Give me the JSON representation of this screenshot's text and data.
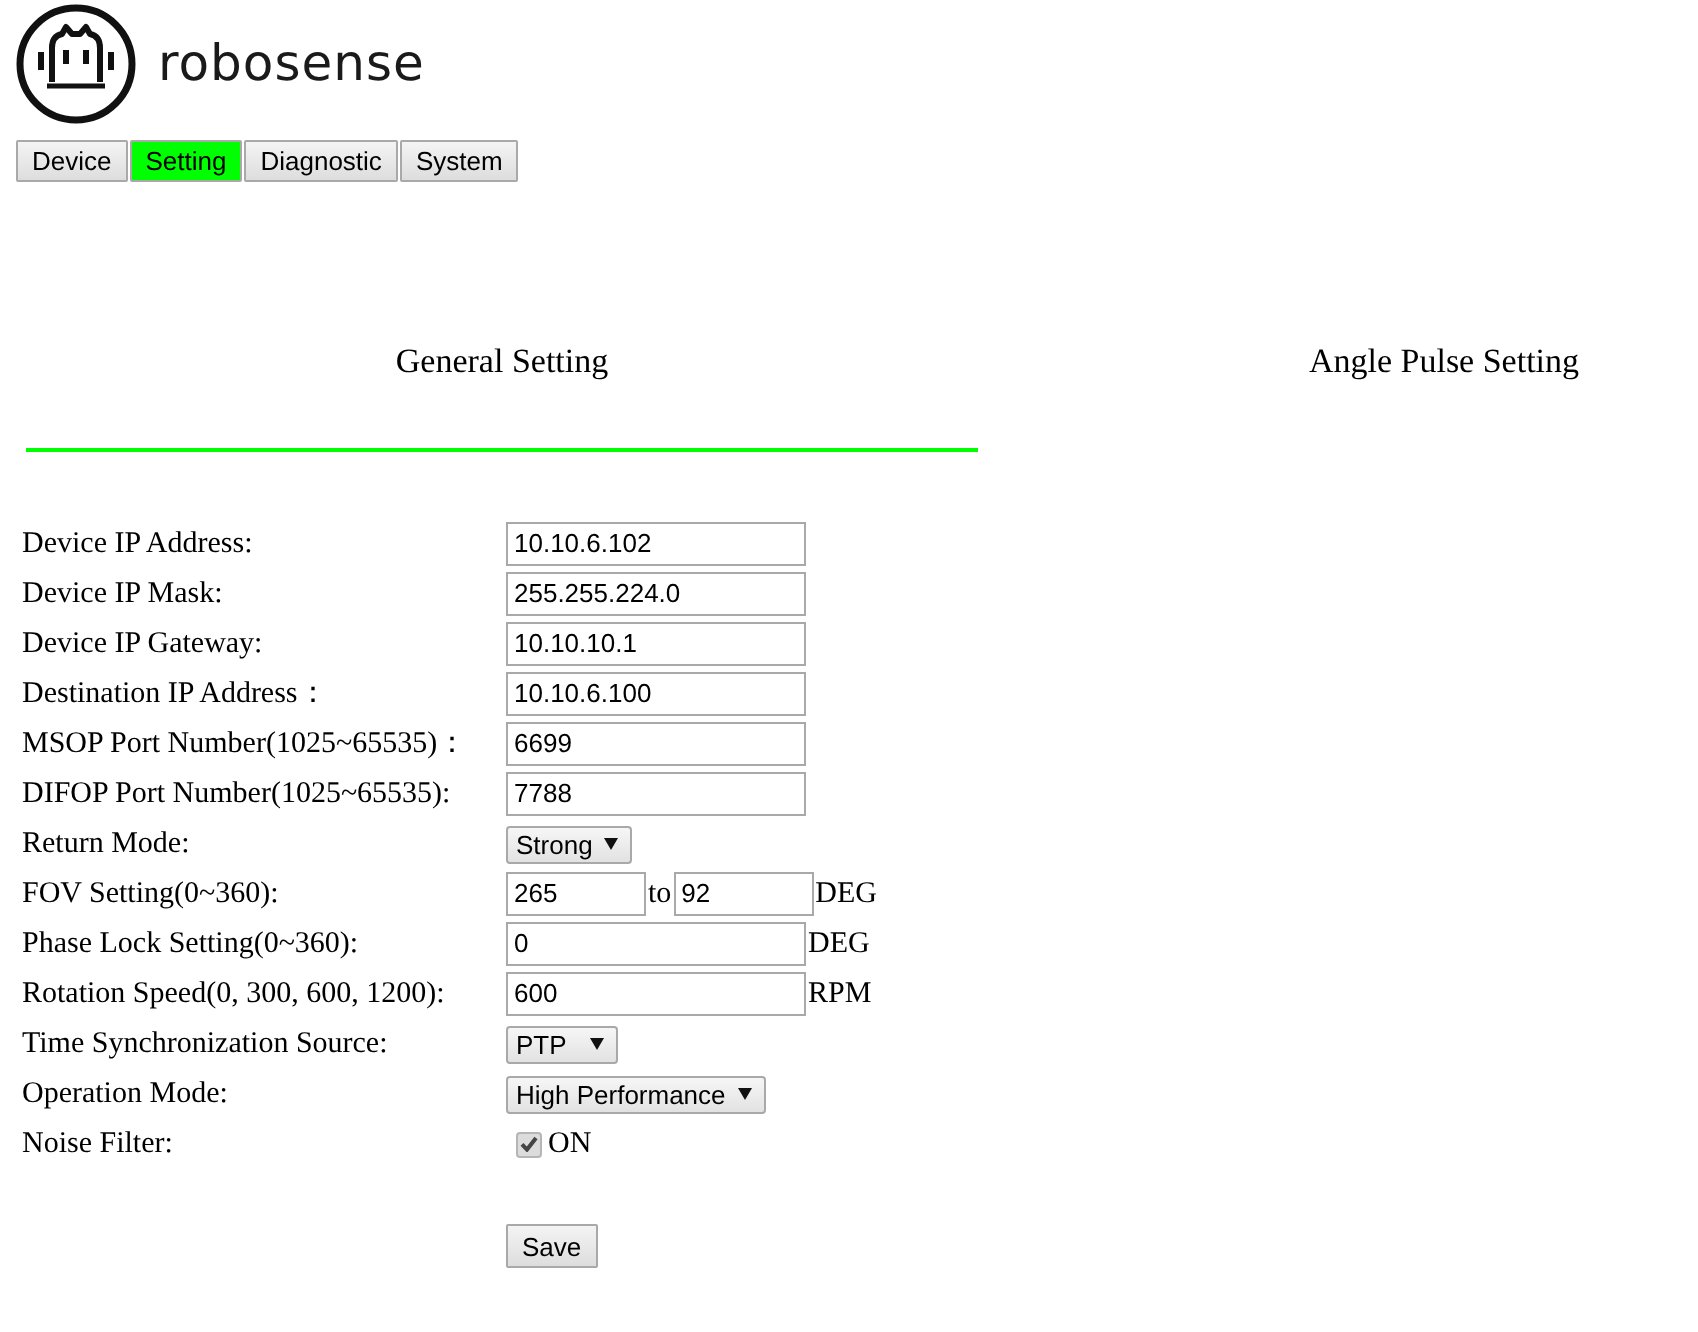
{
  "logo": {
    "text": "robosense"
  },
  "nav_tabs": [
    {
      "label": "Device",
      "selected": false
    },
    {
      "label": "Setting",
      "selected": true
    },
    {
      "label": "Diagnostic",
      "selected": false
    },
    {
      "label": "System",
      "selected": false
    }
  ],
  "section_tabs": [
    {
      "label": "General Setting",
      "selected": true
    },
    {
      "label": "Angle Pulse Setting",
      "selected": false
    }
  ],
  "settings": [
    {
      "kind": "text",
      "label": "Device IP Address:",
      "value": "10.10.6.102"
    },
    {
      "kind": "text",
      "label": "Device IP Mask:",
      "value": "255.255.224.0"
    },
    {
      "kind": "text",
      "label": "Device IP Gateway:",
      "value": "10.10.10.1"
    },
    {
      "kind": "text",
      "label": "Destination IP Address：",
      "value": "10.10.6.100"
    },
    {
      "kind": "text",
      "label": "MSOP Port Number(1025~65535)：",
      "value": "6699"
    },
    {
      "kind": "text",
      "label": "DIFOP Port Number(1025~65535):",
      "value": "7788"
    },
    {
      "kind": "select",
      "label": "Return Mode:",
      "value": "Strong"
    },
    {
      "kind": "range",
      "label": "FOV Setting(0~360):",
      "from": "265",
      "joiner": "to",
      "to": "92",
      "unit": "DEG"
    },
    {
      "kind": "text",
      "label": "Phase Lock Setting(0~360):",
      "value": "0",
      "unit": "DEG"
    },
    {
      "kind": "text",
      "label": "Rotation Speed(0, 300, 600, 1200):",
      "value": "600",
      "unit": "RPM"
    },
    {
      "kind": "select",
      "label": "Time Synchronization Source:",
      "value": "PTP"
    },
    {
      "kind": "select",
      "label": "Operation Mode:",
      "value": "High Performance"
    },
    {
      "kind": "checkbox",
      "label": "Noise Filter:",
      "checked": true,
      "text": "ON"
    }
  ],
  "save_button": "Save"
}
